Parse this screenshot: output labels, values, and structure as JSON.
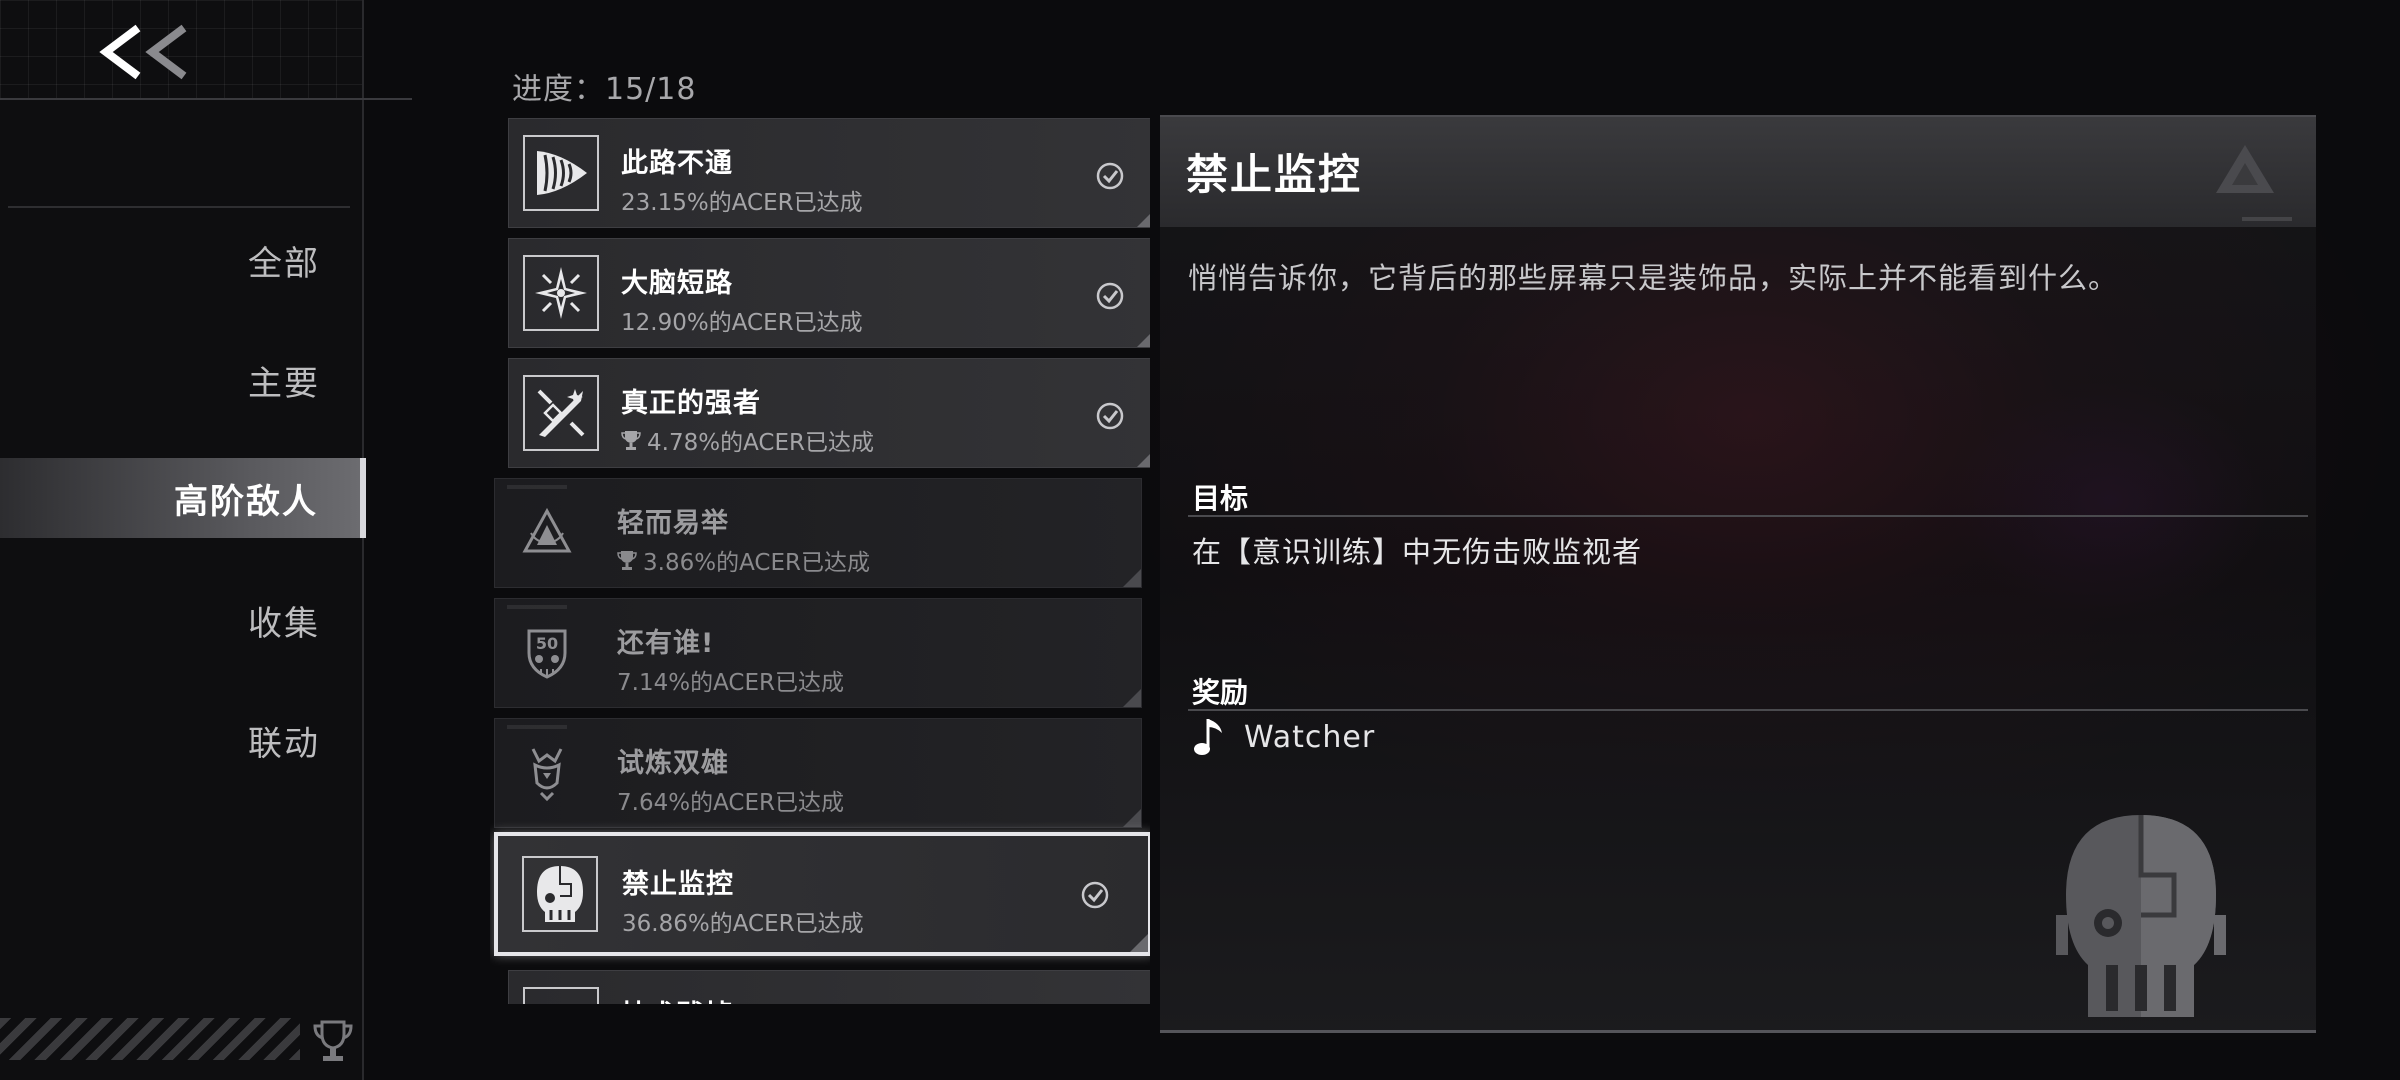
{
  "sidebar": {
    "items": [
      {
        "label": "全部",
        "active": false
      },
      {
        "label": "主要",
        "active": false
      },
      {
        "label": "高阶敌人",
        "active": true
      },
      {
        "label": "收集",
        "active": false
      },
      {
        "label": "联动",
        "active": false
      }
    ]
  },
  "progress": {
    "label": "进度：",
    "value": "15/18"
  },
  "achievements": [
    {
      "title": "此路不通",
      "rate": "23.15%的ACER已达成",
      "icon": "drill-icon",
      "unlocked": true,
      "trophy": false
    },
    {
      "title": "大脑短路",
      "rate": "12.90%的ACER已达成",
      "icon": "spark-star-icon",
      "unlocked": true,
      "trophy": false
    },
    {
      "title": "真正的强者",
      "rate": "4.78%的ACER已达成",
      "icon": "crossed-blades-icon",
      "unlocked": true,
      "trophy": true
    },
    {
      "title": "轻而易举",
      "rate": "3.86%的ACER已达成",
      "icon": "triangle-emblem-icon",
      "unlocked": false,
      "trophy": true
    },
    {
      "title": "还有谁!",
      "rate": "7.14%的ACER已达成",
      "icon": "skull-50-icon",
      "unlocked": false,
      "trophy": false
    },
    {
      "title": "试炼双雄",
      "rate": "7.64%的ACER已达成",
      "icon": "twin-heads-icon",
      "unlocked": false,
      "trophy": false
    },
    {
      "title": "禁止监控",
      "rate": "36.86%的ACER已达成",
      "icon": "watcher-head-icon",
      "unlocked": true,
      "trophy": false,
      "selected": true
    },
    {
      "title": "技术残掉",
      "rate": "",
      "icon": "partial-icon",
      "unlocked": true,
      "trophy": false
    }
  ],
  "detail": {
    "title": "禁止监控",
    "description": "悄悄告诉你，它背后的那些屏幕只是装饰品，实际上并不能看到什么。",
    "goal_label": "目标",
    "goal_text": "在【意识训练】中无伤击败监视者",
    "reward_label": "奖励",
    "reward_icon": "music-note-icon",
    "reward_name": "Watcher"
  },
  "colors": {
    "background": "#0b0b0d",
    "card": "#2a2a2d",
    "accent_glow": "#55142a",
    "selected_border": "#e6e6ea"
  }
}
